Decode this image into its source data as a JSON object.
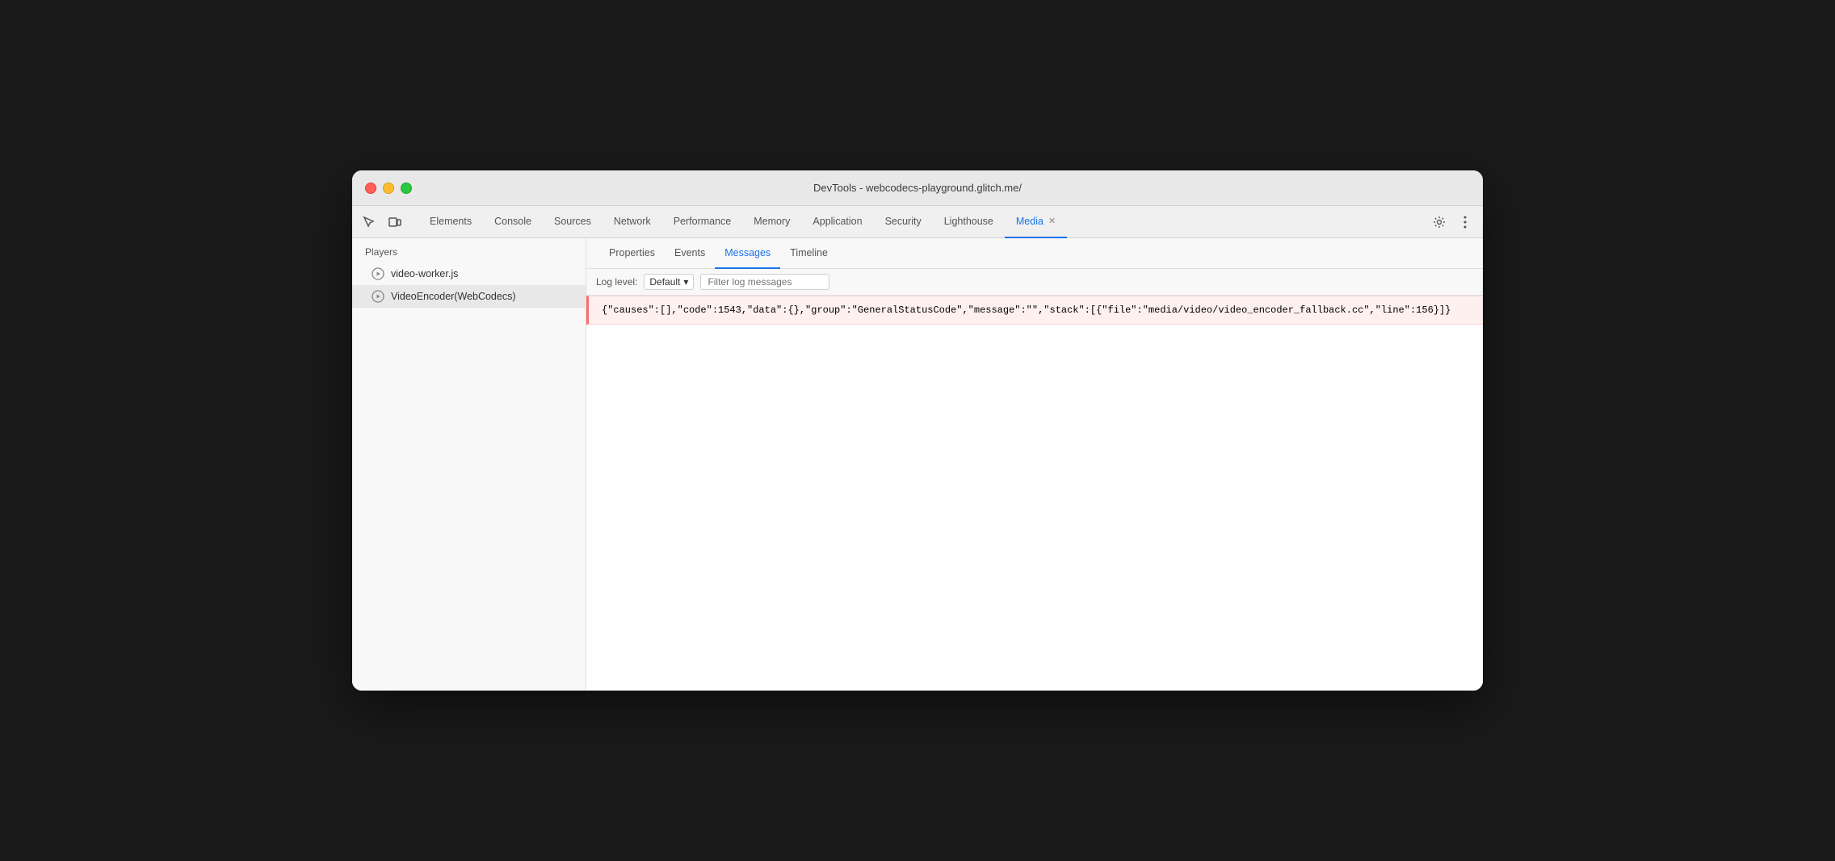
{
  "window": {
    "title": "DevTools - webcodecs-playground.glitch.me/"
  },
  "traffic_lights": {
    "close_label": "close",
    "minimize_label": "minimize",
    "maximize_label": "maximize"
  },
  "devtools": {
    "tabs": [
      {
        "id": "elements",
        "label": "Elements",
        "active": false,
        "closeable": false
      },
      {
        "id": "console",
        "label": "Console",
        "active": false,
        "closeable": false
      },
      {
        "id": "sources",
        "label": "Sources",
        "active": false,
        "closeable": false
      },
      {
        "id": "network",
        "label": "Network",
        "active": false,
        "closeable": false
      },
      {
        "id": "performance",
        "label": "Performance",
        "active": false,
        "closeable": false
      },
      {
        "id": "memory",
        "label": "Memory",
        "active": false,
        "closeable": false
      },
      {
        "id": "application",
        "label": "Application",
        "active": false,
        "closeable": false
      },
      {
        "id": "security",
        "label": "Security",
        "active": false,
        "closeable": false
      },
      {
        "id": "lighthouse",
        "label": "Lighthouse",
        "active": false,
        "closeable": false
      },
      {
        "id": "media",
        "label": "Media",
        "active": true,
        "closeable": true
      }
    ],
    "toolbar_icons": {
      "inspect": "⬚",
      "device": "⬕",
      "settings": "⚙",
      "more": "⋮"
    }
  },
  "sidebar": {
    "header": "Players",
    "items": [
      {
        "id": "video-worker",
        "label": "video-worker.js",
        "selected": false
      },
      {
        "id": "video-encoder",
        "label": "VideoEncoder(WebCodecs)",
        "selected": true
      }
    ]
  },
  "panel": {
    "tabs": [
      {
        "id": "properties",
        "label": "Properties",
        "active": false
      },
      {
        "id": "events",
        "label": "Events",
        "active": false
      },
      {
        "id": "messages",
        "label": "Messages",
        "active": true
      },
      {
        "id": "timeline",
        "label": "Timeline",
        "active": false
      }
    ],
    "toolbar": {
      "log_level_label": "Log level:",
      "log_level_value": "Default",
      "filter_placeholder": "Filter log messages"
    },
    "log_entries": [
      {
        "id": "entry-1",
        "type": "error",
        "text": "{\"causes\":[],\"code\":1543,\"data\":{},\"group\":\"GeneralStatusCode\",\"message\":\"\",\"stack\":[{\"file\":\"media/video/video_encoder_fallback.cc\",\"line\":156}]}"
      }
    ]
  }
}
